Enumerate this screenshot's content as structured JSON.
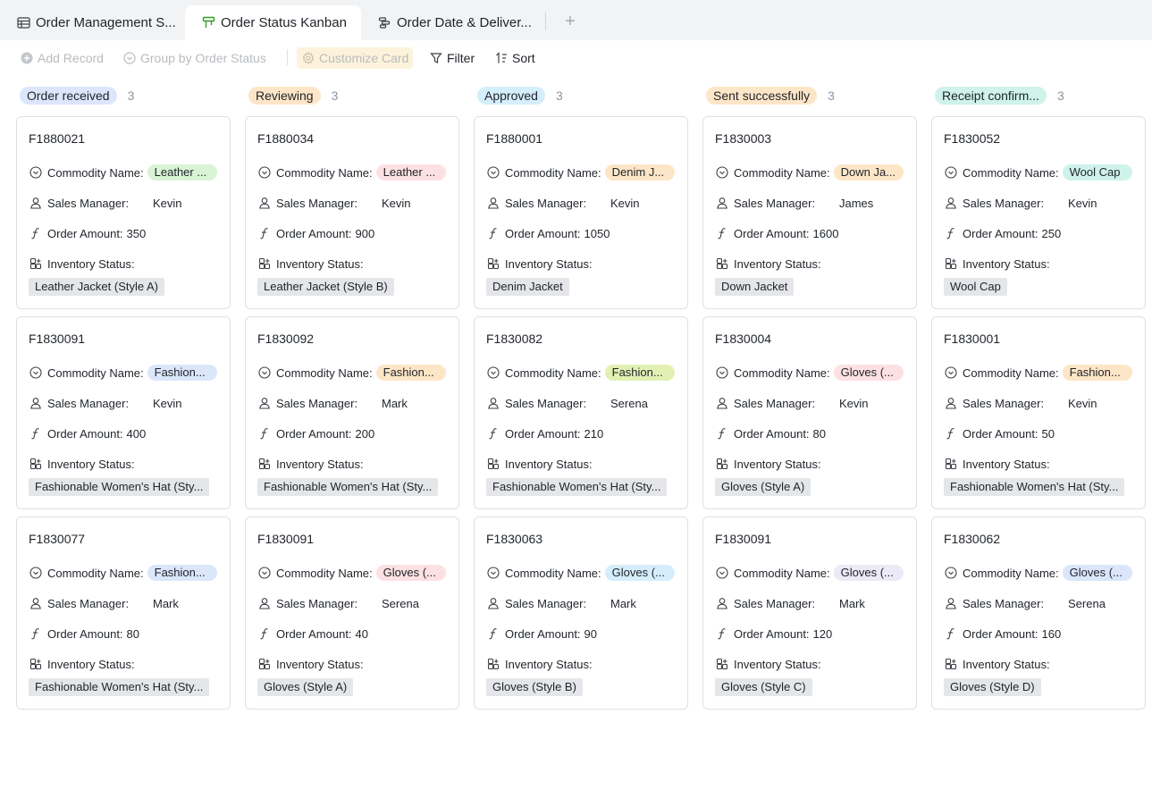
{
  "tabs": [
    {
      "label": "Order Management S...",
      "icon": "grid-table-icon"
    },
    {
      "label": "Order Status Kanban",
      "icon": "kanban-icon"
    },
    {
      "label": "Order Date & Deliver...",
      "icon": "gantt-icon"
    }
  ],
  "toolbar": {
    "add_record": "Add Record",
    "group_by": "Group by Order Status",
    "customize_card": "Customize Card",
    "filter": "Filter",
    "sort": "Sort"
  },
  "field_labels": {
    "commodity": "Commodity Name:",
    "manager": "Sales Manager:",
    "amount": "Order Amount:",
    "inventory": "Inventory Status:"
  },
  "columns": [
    {
      "status": "Order received",
      "status_color": "#dce6fb",
      "count": "3",
      "cards": [
        {
          "id": "F1880021",
          "commodity": "Leather ...",
          "commodity_color": "#d9f3d5",
          "manager": "Kevin",
          "amount": "350",
          "inventory": "Leather Jacket (Style A)"
        },
        {
          "id": "F1830091",
          "commodity": "Fashion...",
          "commodity_color": "#dce6fb",
          "manager": "Kevin",
          "amount": "400",
          "inventory": "Fashionable Women's Hat (Sty..."
        },
        {
          "id": "F1830077",
          "commodity": "Fashion...",
          "commodity_color": "#dce6fb",
          "manager": "Mark",
          "amount": "80",
          "inventory": "Fashionable Women's Hat (Sty..."
        }
      ]
    },
    {
      "status": "Reviewing",
      "status_color": "#fde6c7",
      "count": "3",
      "cards": [
        {
          "id": "F1880034",
          "commodity": "Leather ...",
          "commodity_color": "#fde1e2",
          "manager": "Kevin",
          "amount": "900",
          "inventory": "Leather Jacket (Style B)"
        },
        {
          "id": "F1830092",
          "commodity": "Fashion...",
          "commodity_color": "#fde6c7",
          "manager": "Mark",
          "amount": "200",
          "inventory": "Fashionable Women's Hat (Sty..."
        },
        {
          "id": "F1830091",
          "commodity": "Gloves (...",
          "commodity_color": "#fde1e2",
          "manager": "Serena",
          "amount": "40",
          "inventory": "Gloves (Style A)"
        }
      ]
    },
    {
      "status": "Approved",
      "status_color": "#d5eefb",
      "count": "3",
      "cards": [
        {
          "id": "F1880001",
          "commodity": "Denim J...",
          "commodity_color": "#fde6c7",
          "manager": "Kevin",
          "amount": "1050",
          "inventory": "Denim Jacket"
        },
        {
          "id": "F1830082",
          "commodity": "Fashion...",
          "commodity_color": "#e3f0b4",
          "manager": "Serena",
          "amount": "210",
          "inventory": "Fashionable Women's Hat (Sty..."
        },
        {
          "id": "F1830063",
          "commodity": "Gloves (...",
          "commodity_color": "#d5eefb",
          "manager": "Mark",
          "amount": "90",
          "inventory": "Gloves (Style B)"
        }
      ]
    },
    {
      "status": "Sent successfully",
      "status_color": "#fde6c7",
      "count": "3",
      "cards": [
        {
          "id": "F1830003",
          "commodity": "Down Ja...",
          "commodity_color": "#fde6c7",
          "manager": "James",
          "amount": "1600",
          "inventory": "Down Jacket"
        },
        {
          "id": "F1830004",
          "commodity": "Gloves (...",
          "commodity_color": "#fde1e2",
          "manager": "Kevin",
          "amount": "80",
          "inventory": "Gloves (Style A)"
        },
        {
          "id": "F1830091",
          "commodity": "Gloves (...",
          "commodity_color": "#eceaf6",
          "manager": "Mark",
          "amount": "120",
          "inventory": "Gloves (Style C)"
        }
      ]
    },
    {
      "status": "Receipt confirm...",
      "status_color": "#cff2ea",
      "count": "3",
      "cards": [
        {
          "id": "F1830052",
          "commodity": "Wool Cap",
          "commodity_color": "#cff2ea",
          "manager": "Kevin",
          "amount": "250",
          "inventory": "Wool Cap"
        },
        {
          "id": "F1830001",
          "commodity": "Fashion...",
          "commodity_color": "#fde6c7",
          "manager": "Kevin",
          "amount": "50",
          "inventory": "Fashionable Women's Hat (Sty..."
        },
        {
          "id": "F1830062",
          "commodity": "Gloves (...",
          "commodity_color": "#dce6fb",
          "manager": "Serena",
          "amount": "160",
          "inventory": "Gloves (Style D)"
        }
      ]
    }
  ]
}
